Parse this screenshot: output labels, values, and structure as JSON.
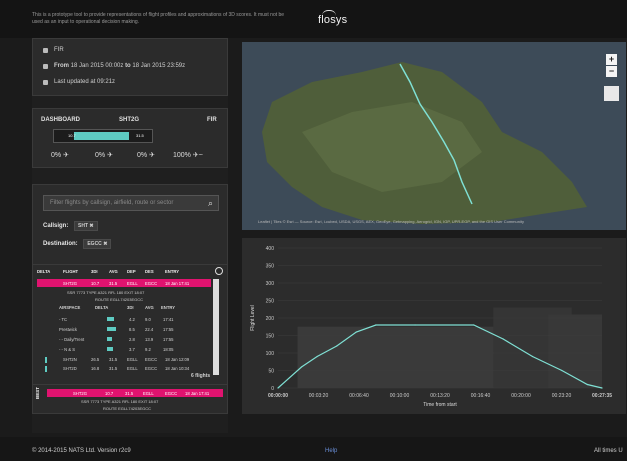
{
  "header": {
    "disclaimer": "This is a prototype tool to provide representations of flight profiles and approximations of 3D scores. It must not be used as an input to operational decision making.",
    "logo_text": "flosys"
  },
  "info": {
    "fir": "FIR",
    "date_from_label": "From",
    "date_from": "18 Jan 2015 00:00z",
    "date_to_label": "to",
    "date_to": "18 Jan 2015 23:59z",
    "last_updated": "Last updated at 09:21z"
  },
  "dashboard": {
    "label": "DASHBOARD",
    "callsign": "SHT2G",
    "right_label": "FIR",
    "low_value": "10.7",
    "high_value": "31.5",
    "bar_fraction": 0.55,
    "legend": [
      {
        "pct": "0%",
        "icon": "climb-plane-icon"
      },
      {
        "pct": "0%",
        "icon": "cruise-plane-icon"
      },
      {
        "pct": "0%",
        "icon": "descent-plane-icon"
      },
      {
        "pct": "100%",
        "icon": "plane-trail-icon"
      }
    ]
  },
  "filter": {
    "search_placeholder": "Filter flights by callsign, airfield, route or sector",
    "callsign_label": "Callsign:",
    "callsign_chip": "SHT",
    "destination_label": "Destination:",
    "destination_chip": "EGCC"
  },
  "table": {
    "headers": [
      "DELTA",
      "FLIGHT",
      "3DI",
      "AVG",
      "DEP",
      "DES",
      "ENTRY"
    ],
    "selected_row": [
      "SHT2G",
      "10.7",
      "31.5",
      "EGLL",
      "EGCC",
      "18 Jan 17:41"
    ],
    "detail_line1": "SSR 7773  TYPE A321  RFL 180  EXIT 18:07",
    "detail_line2": "ROUTE EGLL74203EGCC",
    "sub_headers": [
      "AIRSPACE",
      "DELTA",
      "3DI",
      "AVG",
      "ENTRY"
    ],
    "sub_rows": [
      {
        "name": "- TC",
        "avg": "4.2",
        "v2": "9.0",
        "entry": "17:41",
        "bar": 0.5
      },
      {
        "name": "Prestwick",
        "avg": "8.5",
        "v2": "22.4",
        "entry": "17:55",
        "bar": 0.65
      },
      {
        "name": "- - Daily/Trent",
        "avg": "2.8",
        "v2": "13.9",
        "entry": "17:55",
        "bar": 0.35
      },
      {
        "name": "- - N & S",
        "avg": "3.7",
        "v2": "9.2",
        "entry": "18:05",
        "bar": 0.4
      }
    ],
    "other_rows": [
      {
        "flight": "SHT2N",
        "v1": "26.5",
        "v2": "31.5",
        "dep": "EGLL",
        "des": "EGCC",
        "entry": "18 Jan 12:09"
      },
      {
        "flight": "SHT2D",
        "v1": "16.8",
        "v2": "31.5",
        "dep": "EGLL",
        "des": "EGCC",
        "entry": "18 Jan 10:34"
      }
    ],
    "count": "6 flights",
    "best_label": "BEST",
    "best_row": [
      "SHT2G",
      "10.7",
      "31.5",
      "EGLL",
      "EGCC",
      "18 Jan 17:41"
    ],
    "best_detail1": "SSR 7773  TYPE A321  RFL 180  EXIT 18:07",
    "best_detail2": "ROUTE EGLL74203EGCC"
  },
  "map": {
    "zoom_in": "+",
    "zoom_out": "−",
    "attribution": "Leaflet | Tiles © Esri — Source: Esri, i-cubed, USDA, USGS, AEX, GeoEye, Getmapping, Aerogrid, IGN, IGP, UPR-EGP, and the GIS User Community"
  },
  "chart_data": {
    "type": "line",
    "ylabel": "Flight Level",
    "xlabel": "Time from start",
    "x_ticks": [
      "00:00:00",
      "00:03:20",
      "00:06:40",
      "00:10:00",
      "00:13:20",
      "00:16:40",
      "00:20:00",
      "00:23:20",
      "00:27:35"
    ],
    "y_ticks": [
      0,
      50,
      100,
      150,
      200,
      250,
      300,
      350,
      400
    ],
    "ylim": [
      0,
      400
    ],
    "xlim_seconds": [
      0,
      1655
    ],
    "series": [
      {
        "x": [
          0,
          120,
          200,
          300,
          400,
          500,
          700,
          1000,
          1150,
          1300,
          1450,
          1580,
          1655
        ],
        "y": [
          0,
          60,
          90,
          120,
          160,
          180,
          180,
          180,
          140,
          90,
          50,
          10,
          0
        ]
      }
    ]
  },
  "footer": {
    "copyright": "© 2014-2015 NATS Ltd.  Version r2c9",
    "help": "Help",
    "times": "All times U"
  }
}
